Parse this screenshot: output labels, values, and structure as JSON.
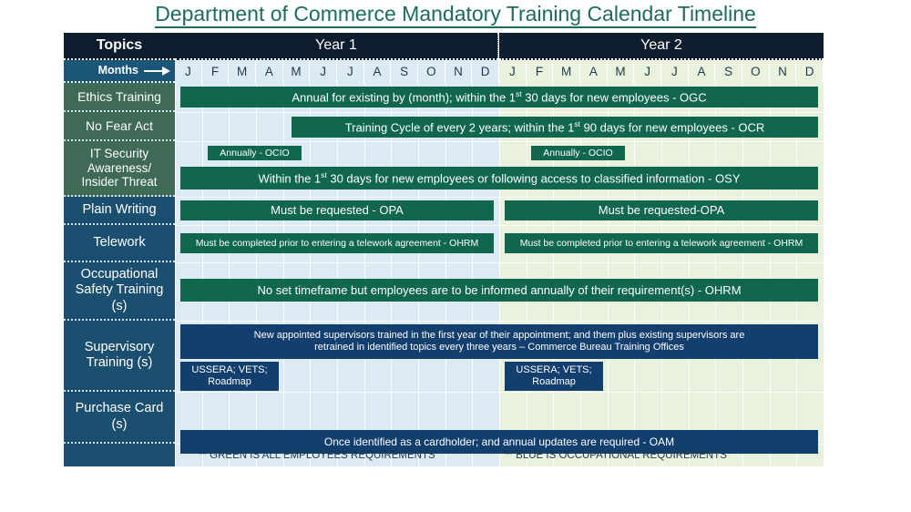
{
  "title": "Department of Commerce Mandatory Training Calendar Timeline",
  "header": {
    "topics_label": "Topics",
    "months_label": "Months",
    "year1_label": "Year 1",
    "year2_label": "Year 2"
  },
  "months": [
    "J",
    "F",
    "M",
    "A",
    "M",
    "J",
    "J",
    "A",
    "S",
    "O",
    "N",
    "D"
  ],
  "topics": [
    {
      "label": "Ethics Training",
      "style": "green"
    },
    {
      "label": "No Fear Act",
      "style": "green"
    },
    {
      "label": "IT Security Awareness/ Insider Threat",
      "style": "green"
    },
    {
      "label": "Plain Writing",
      "style": "blue"
    },
    {
      "label": "Telework",
      "style": "blue"
    },
    {
      "label": "Occupational Safety Training (s)",
      "style": "blue"
    },
    {
      "label": "Supervisory Training (s)",
      "style": "blue"
    },
    {
      "label": "Purchase Card (s)",
      "style": "blue"
    },
    {
      "label": "",
      "style": "blue"
    }
  ],
  "bars": {
    "ethics": "Annual for existing by (month); within the 1st 30 days for new employees - OGC",
    "nofear": "Training Cycle of every 2 years; within the 1st 90 days for new employees - OCR",
    "itsec_y1_annual": "Annually - OCIO",
    "itsec_y2_annual": "Annually - OCIO",
    "itsec_full": "Within the 1st 30 days for new employees or following access to classified information - OSY",
    "plain_y1": "Must be requested - OPA",
    "plain_y2": "Must be requested-OPA",
    "telework_y1": "Must be completed prior to entering a telework agreement - OHRM",
    "telework_y2": "Must be completed prior to entering a telework agreement - OHRM",
    "occsafety": "No set timeframe but employees are to be informed annually of their requirement(s) - OHRM",
    "supervisory_line1": "New appointed supervisors trained in the first year of their appointment; and them plus existing supervisors are",
    "supervisory_line2": "retrained in identified topics every three years – Commerce Bureau Training Offices",
    "ussera_y1_line1": "USSERA; VETS;",
    "ussera_y1_line2": "Roadmap",
    "ussera_y2_line1": "USSERA; VETS;",
    "ussera_y2_line2": "Roadmap",
    "purchase": "Once identified as a cardholder; and annual updates are required - OAM"
  },
  "legend": {
    "green_note": "** GREEN IS ALL EMPLOYEES REQUIREMENTS",
    "blue_note": "** BLUE IS OCCUPATIONAL REQUIREMENTS"
  },
  "colors": {
    "title": "#1d6b5f",
    "header_bar": "#0e1d2e",
    "topic_green": "#3f6b56",
    "topic_blue": "#1b4f70",
    "bar_green": "#10674e",
    "bar_blue": "#123f6e",
    "year1_bg": "#dceaf4",
    "year2_bg": "#e9f2dd"
  }
}
